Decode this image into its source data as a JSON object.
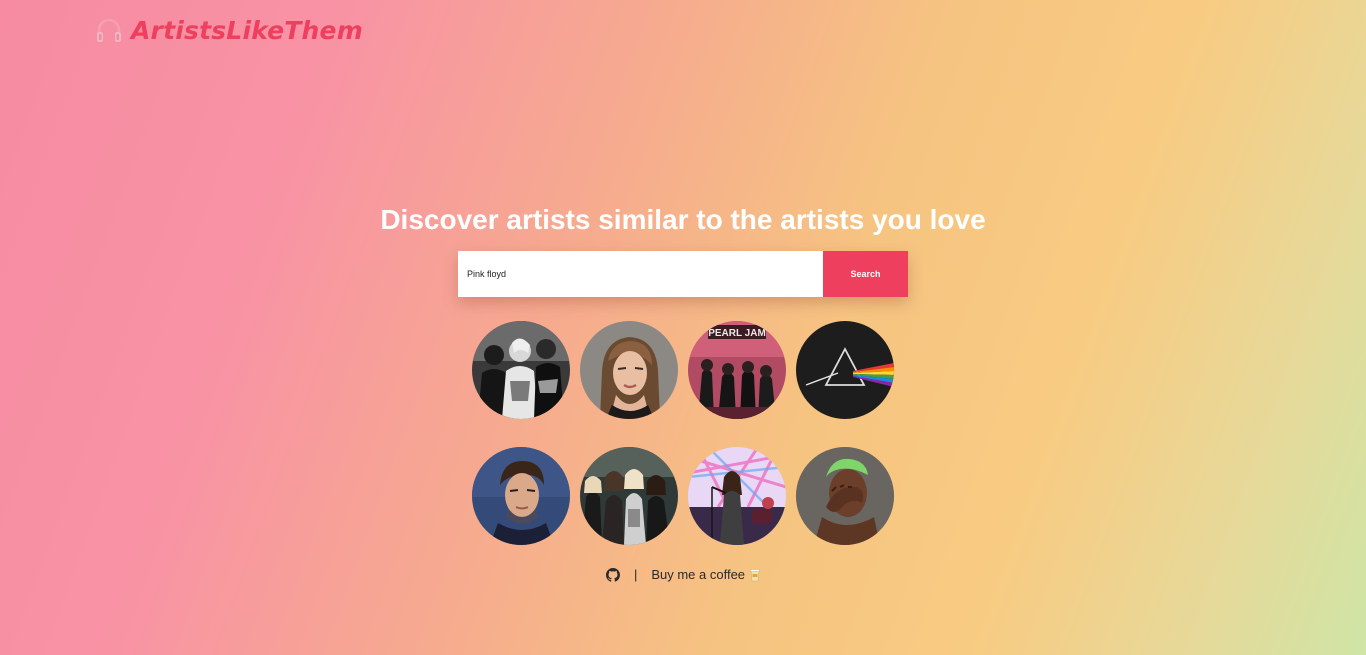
{
  "brand": {
    "name": "ArtistsLikeThem",
    "icon": "headphones-icon",
    "color": "#ee3f5e"
  },
  "hero": {
    "headline": "Discover artists similar to the artists you love"
  },
  "search": {
    "value": "Pink floyd",
    "button_label": "Search"
  },
  "artists": [
    {
      "icon": "grunge-band-photo"
    },
    {
      "icon": "female-singer-portrait"
    },
    {
      "icon": "band-live-photo"
    },
    {
      "icon": "prism-album-cover"
    },
    {
      "icon": "male-singer-portrait"
    },
    {
      "icon": "rock-band-photo"
    },
    {
      "icon": "concert-stage-photo"
    },
    {
      "icon": "artist-face-portrait"
    }
  ],
  "footer": {
    "separator": "|",
    "coffee_label": "Buy me a coffee",
    "github_icon": "github-icon",
    "coffee_icon": "coffee-icon"
  }
}
